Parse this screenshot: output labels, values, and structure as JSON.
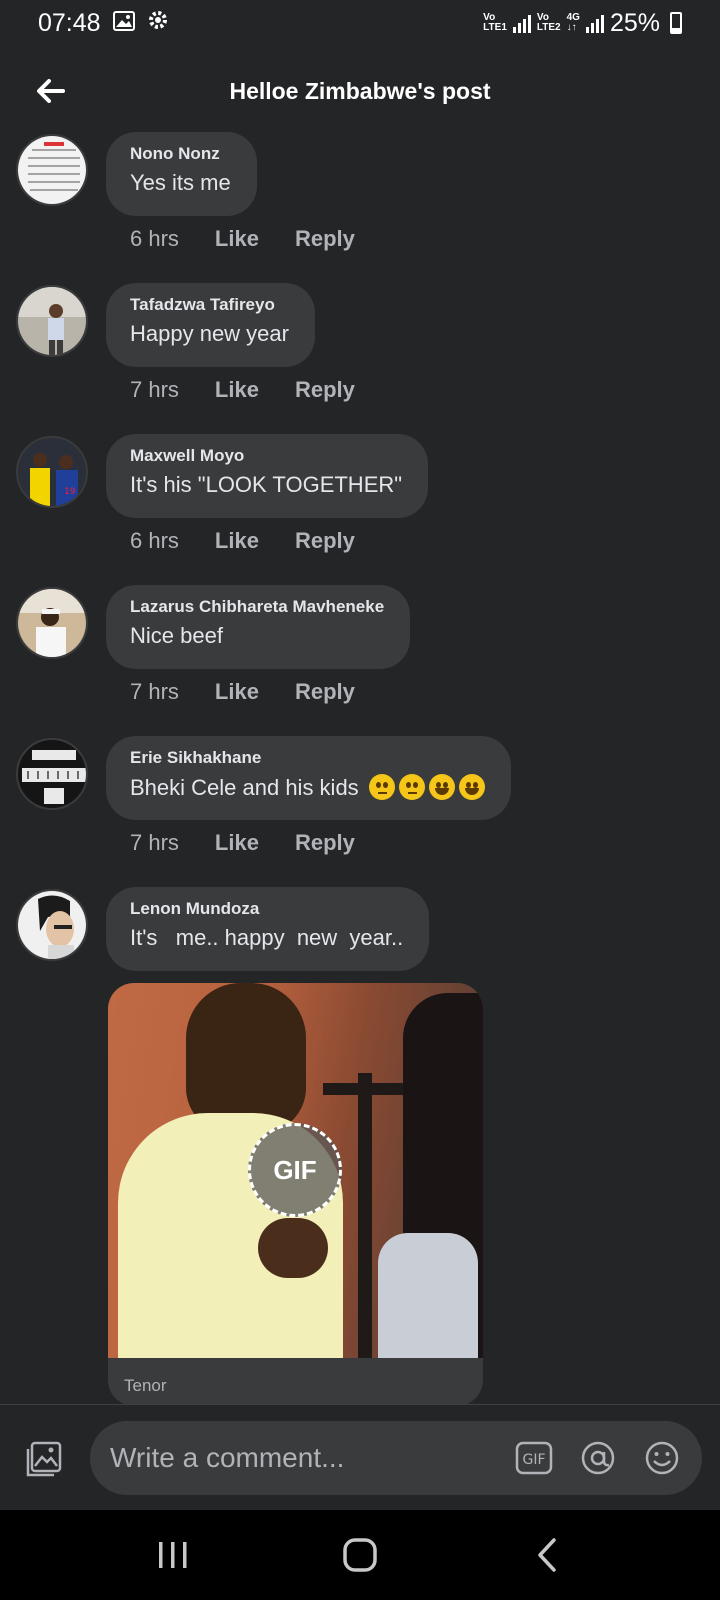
{
  "status_bar": {
    "time": "07:48",
    "sim1_top": "Vo",
    "sim1_bottom": "LTE1",
    "sim2_top": "Vo",
    "sim2_bottom": "LTE2",
    "network": "4G",
    "battery": "25%",
    "battery_level": 0.25
  },
  "header": {
    "title": "Helloe Zimbabwe's post"
  },
  "comments": [
    {
      "author": "Nono Nonz",
      "text": "Yes its me",
      "time": "6 hrs",
      "like": "Like",
      "reply": "Reply"
    },
    {
      "author": "Tafadzwa Tafireyo",
      "text": "Happy new year",
      "time": "7 hrs",
      "like": "Like",
      "reply": "Reply"
    },
    {
      "author": "Maxwell Moyo",
      "text": "It's his \"LOOK TOGETHER\"",
      "time": "6 hrs",
      "like": "Like",
      "reply": "Reply"
    },
    {
      "author": "Lazarus Chibhareta Mavheneke",
      "text": "Nice beef",
      "time": "7 hrs",
      "like": "Like",
      "reply": "Reply"
    },
    {
      "author": "Erie Sikhakhane",
      "text": "Bheki Cele and his kids",
      "emojis": [
        "face-with-rolling-eyes",
        "face-with-rolling-eyes",
        "grinning-face",
        "grinning-face"
      ],
      "time": "7 hrs",
      "like": "Like",
      "reply": "Reply"
    },
    {
      "author": "Lenon Mundoza",
      "text": "It's   me.. happy  new  year..",
      "time": "",
      "like": "",
      "reply": ""
    }
  ],
  "gif": {
    "badge": "GIF",
    "source": "Tenor"
  },
  "composer": {
    "placeholder": "Write a comment...",
    "gif_label": "GIF"
  },
  "colors": {
    "background": "#242527",
    "bubble": "#3a3b3c",
    "text_primary": "#e4e6eb",
    "text_secondary": "#b0b3b8"
  }
}
